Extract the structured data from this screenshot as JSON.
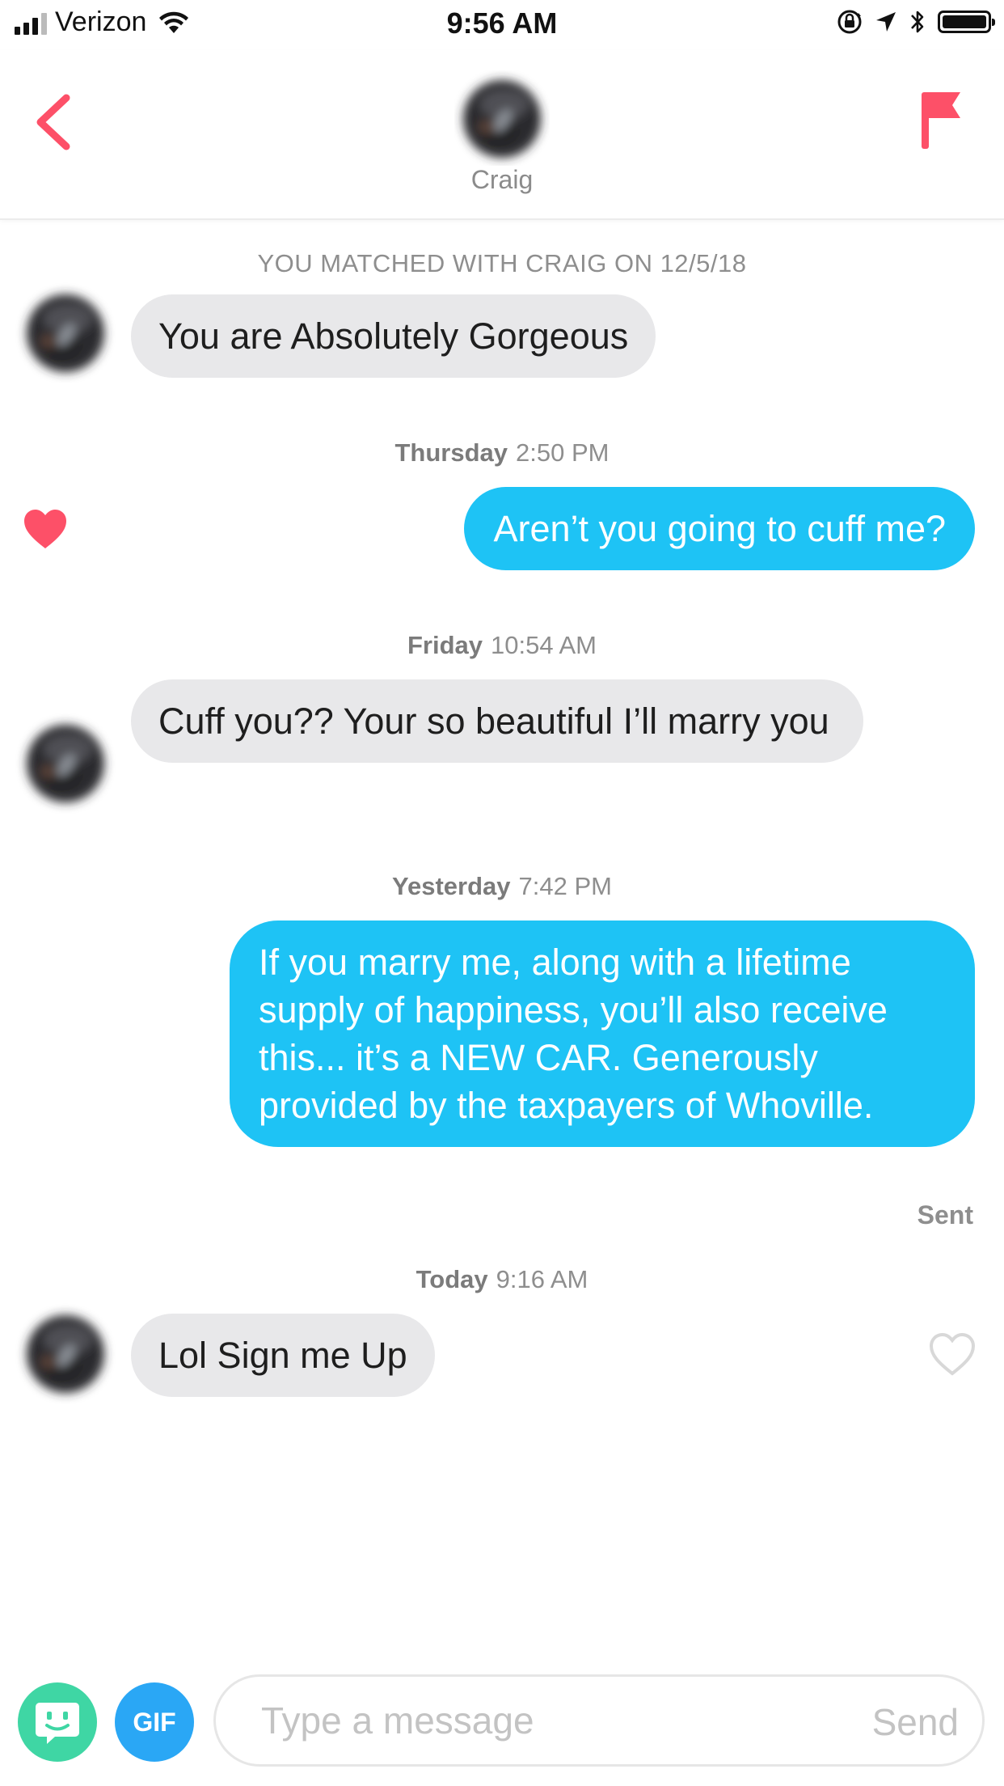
{
  "status_bar": {
    "carrier": "Verizon",
    "time": "9:56 AM"
  },
  "header": {
    "name": "Craig"
  },
  "colors": {
    "accent": "#fd5068",
    "outgoing_bubble": "#1ec3f5",
    "incoming_bubble": "#e8e8ea"
  },
  "chat": {
    "match_line": "YOU MATCHED WITH CRAIG ON 12/5/18",
    "messages": [
      {
        "text": "You are Absolutely Gorgeous"
      },
      {
        "day": "Thursday",
        "time": "2:50 PM",
        "text": "Aren’t you going to cuff me?"
      },
      {
        "day": "Friday",
        "time": "10:54 AM",
        "text": "Cuff you?? Your so beautiful I’ll marry you"
      },
      {
        "day": "Yesterday",
        "time": "7:42 PM",
        "text": "If you marry me, along with a lifetime supply of happiness, you’ll also receive this... it’s a NEW CAR. Generously provided by the taxpayers of Whoville.",
        "status": "Sent"
      },
      {
        "day": "Today",
        "time": "9:16 AM",
        "text": "Lol Sign me Up"
      }
    ]
  },
  "composer": {
    "gif_label": "GIF",
    "placeholder": "Type a message",
    "send_label": "Send"
  }
}
